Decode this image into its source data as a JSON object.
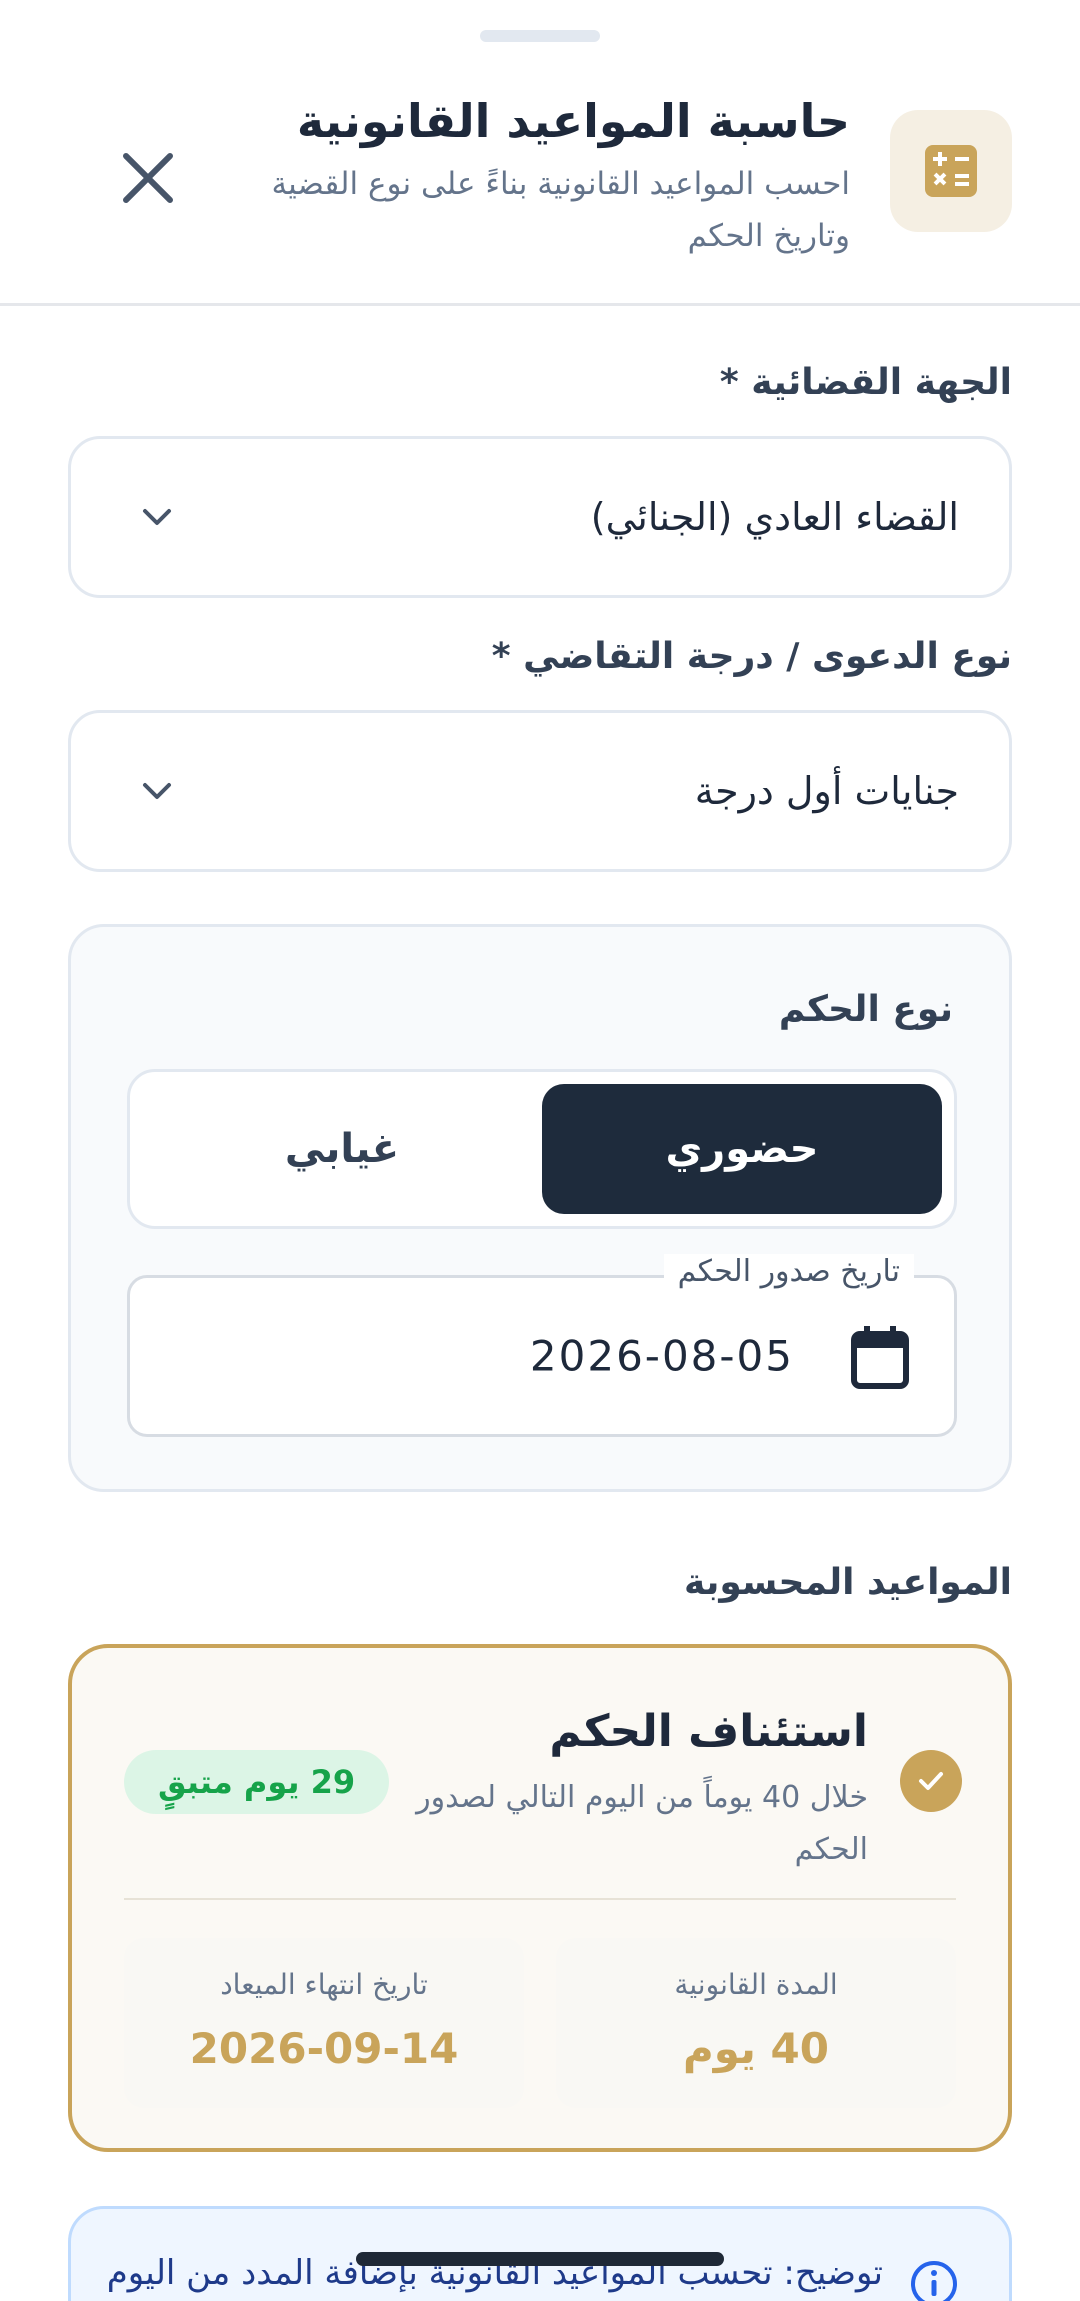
{
  "header": {
    "title": "حاسبة المواعيد القانونية",
    "subtitle": "احسب المواعيد القانونية بناءً على نوع القضية وتاريخ الحكم",
    "app_icon": "calculator-icon",
    "close_icon": "close-icon"
  },
  "form": {
    "court": {
      "label": "الجهة القضائية *",
      "value": "القضاء العادي (الجنائي)"
    },
    "case_type": {
      "label": "نوع الدعوى / درجة التقاضي *",
      "value": "جنايات أول درجة"
    },
    "verdict": {
      "title": "نوع الحكم",
      "options": [
        "حضوري",
        "غيابي"
      ],
      "selected": "حضوري"
    },
    "date": {
      "label": "تاريخ صدور الحكم",
      "value": "2026-08-05"
    }
  },
  "results": {
    "title": "المواعيد المحسوبة",
    "items": [
      {
        "title": "استئناف الحكم",
        "description": "خلال 40 يوماً من اليوم التالي لصدور الحكم",
        "badge": "29 يوم متبقٍ",
        "duration_label": "المدة القانونية",
        "duration_value": "40 يوم",
        "deadline_label": "تاريخ انتهاء الميعاد",
        "deadline_value": "2026-09-14"
      }
    ]
  },
  "note": {
    "text": "توضيح: تحسب المواعيد القانونية بإضافة المدد من اليوم"
  },
  "colors": {
    "accent_gold": "#c9a45a",
    "dark": "#1e2b3c",
    "success": "#16a34a",
    "info": "#2563eb"
  }
}
